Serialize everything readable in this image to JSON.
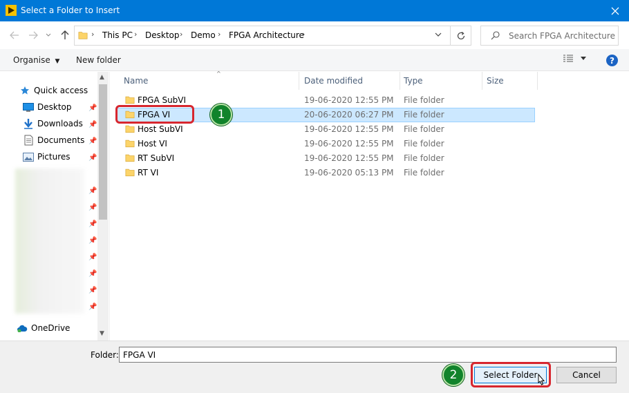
{
  "window": {
    "title": "Select a Folder to Insert",
    "close_icon": "close-icon",
    "title_bar_color": "#0078d7"
  },
  "nav": {
    "breadcrumbs": [
      "This PC",
      "Desktop",
      "Demo",
      "FPGA Architecture"
    ],
    "search_placeholder": "Search FPGA Architecture"
  },
  "toolbar": {
    "organise_label": "Organise",
    "new_folder_label": "New folder",
    "help_label": "?"
  },
  "sidebar": {
    "items": [
      {
        "label": "Quick access",
        "icon": "star-icon"
      },
      {
        "label": "Desktop",
        "icon": "desktop-icon"
      },
      {
        "label": "Downloads",
        "icon": "download-icon"
      },
      {
        "label": "Documents",
        "icon": "document-icon"
      },
      {
        "label": "Pictures",
        "icon": "picture-icon"
      },
      {
        "label": "OneDrive",
        "icon": "cloud-icon"
      }
    ]
  },
  "columns": {
    "name": "Name",
    "date_modified": "Date modified",
    "type": "Type",
    "size": "Size"
  },
  "files": [
    {
      "name": "FPGA SubVI",
      "date": "19-06-2020 12:55 PM",
      "type": "File folder"
    },
    {
      "name": "FPGA VI",
      "date": "20-06-2020 06:27 PM",
      "type": "File folder"
    },
    {
      "name": "Host SubVI",
      "date": "19-06-2020 12:55 PM",
      "type": "File folder"
    },
    {
      "name": "Host VI",
      "date": "19-06-2020 12:55 PM",
      "type": "File folder"
    },
    {
      "name": "RT SubVI",
      "date": "19-06-2020 12:55 PM",
      "type": "File folder"
    },
    {
      "name": "RT VI",
      "date": "19-06-2020 05:13 PM",
      "type": "File folder"
    }
  ],
  "selected_file": "FPGA VI",
  "footer": {
    "folder_label": "Folder:",
    "folder_value": "FPGA VI",
    "select_button": "Select Folder",
    "cancel_button": "Cancel"
  },
  "annotations": {
    "step1": "1",
    "step2": "2",
    "highlight_color": "#d7262e",
    "badge_color": "#11832b"
  }
}
